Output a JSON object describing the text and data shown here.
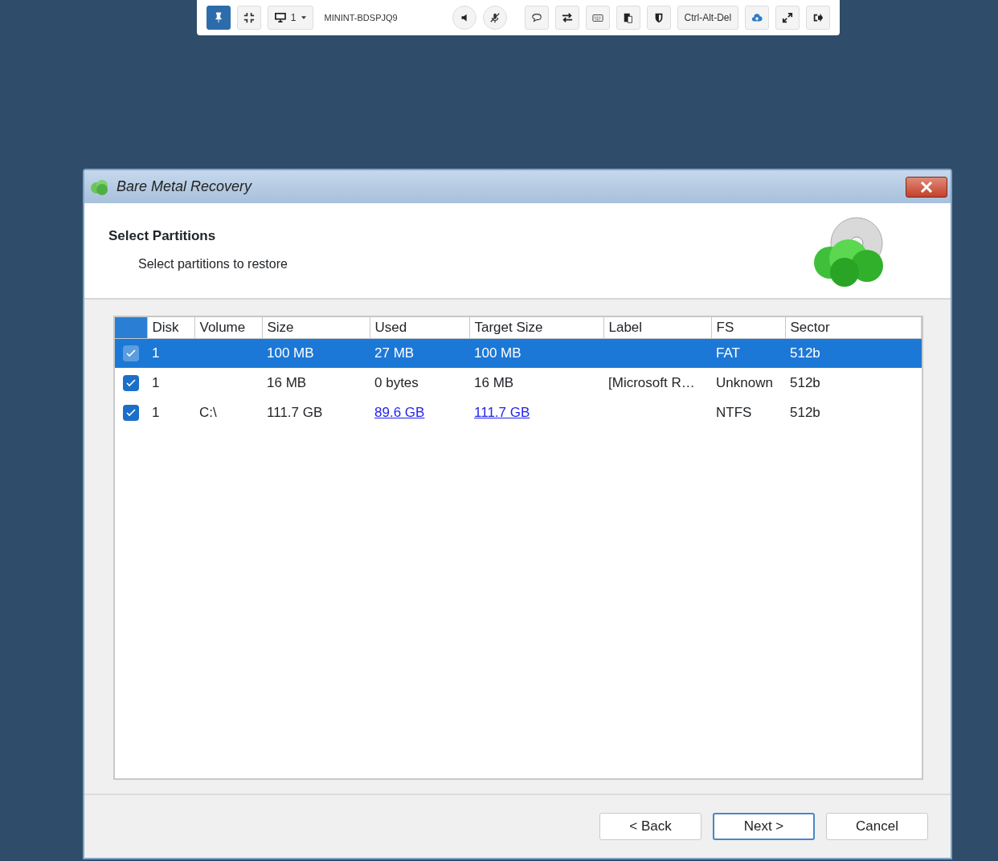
{
  "toolbar": {
    "items": [
      {
        "kind": "pin",
        "pressed": true
      },
      {
        "kind": "compress",
        "pressed": false
      },
      {
        "kind": "monitor",
        "text": "1"
      },
      {
        "kind": "label",
        "text": "MININT-BDSPJQ9"
      },
      {
        "kind": "speaker",
        "pressed": false
      },
      {
        "kind": "mic-off",
        "pressed": false
      },
      {
        "kind": "chat",
        "pressed": false
      },
      {
        "kind": "swap",
        "pressed": false
      },
      {
        "kind": "keyboard",
        "pressed": false
      },
      {
        "kind": "clipboard",
        "pressed": false
      },
      {
        "kind": "shield",
        "pressed": false
      },
      {
        "kind": "text",
        "text": "Ctrl-Alt-Del"
      },
      {
        "kind": "upload",
        "pressed": false
      },
      {
        "kind": "expand",
        "pressed": false
      },
      {
        "kind": "exit",
        "pressed": false
      }
    ]
  },
  "window": {
    "title": "Bare Metal Recovery"
  },
  "header": {
    "title": "Select Partitions",
    "subtitle": "Select partitions to restore"
  },
  "table": {
    "columns": [
      "Disk",
      "Volume",
      "Size",
      "Used",
      "Target Size",
      "Label",
      "FS",
      "Sector"
    ],
    "rows": [
      {
        "selected": true,
        "checked": true,
        "links": false,
        "cells": [
          "1",
          "",
          "100 MB",
          "27 MB",
          "100 MB",
          "",
          "FAT",
          "512b"
        ]
      },
      {
        "selected": false,
        "checked": true,
        "links": false,
        "cells": [
          "1",
          "",
          "16 MB",
          "0 bytes",
          "16 MB",
          "[Microsoft R…",
          "Unknown",
          "512b"
        ]
      },
      {
        "selected": false,
        "checked": true,
        "links": true,
        "cells": [
          "1",
          "C:\\",
          "111.7 GB",
          "89.6 GB",
          "111.7 GB",
          "",
          "NTFS",
          "512b"
        ]
      }
    ]
  },
  "buttons": [
    {
      "label": "< Back",
      "default": false
    },
    {
      "label": "Next >",
      "default": true
    },
    {
      "label": "Cancel",
      "default": false
    }
  ]
}
